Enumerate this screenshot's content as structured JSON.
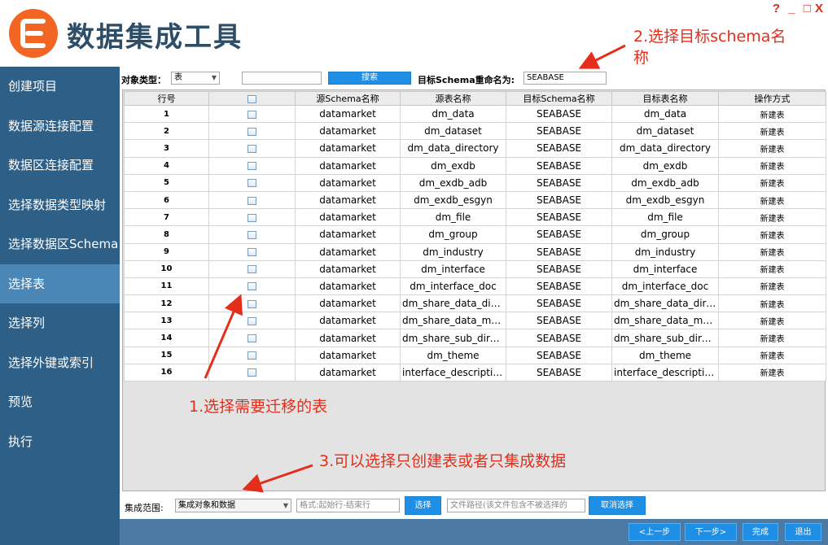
{
  "app": {
    "title": "数据集成工具",
    "window_controls": [
      "?",
      "_",
      "□",
      "X"
    ]
  },
  "sidebar": {
    "items": [
      {
        "label": "创建项目",
        "active": false
      },
      {
        "label": "数据源连接配置",
        "active": false
      },
      {
        "label": "数据区连接配置",
        "active": false
      },
      {
        "label": "选择数据类型映射",
        "active": false
      },
      {
        "label": "选择数据区Schema",
        "active": false
      },
      {
        "label": "选择表",
        "active": true
      },
      {
        "label": "选择列",
        "active": false
      },
      {
        "label": "选择外键或索引",
        "active": false
      },
      {
        "label": "预览",
        "active": false
      },
      {
        "label": "执行",
        "active": false
      }
    ]
  },
  "toolbar": {
    "object_type_label": "对象类型：",
    "object_type_value": "表",
    "search_value": "",
    "search_button": "搜索",
    "rename_label": "目标Schema重命名为:",
    "rename_value": "SEABASE"
  },
  "table": {
    "columns": [
      "行号",
      "",
      "源Schema名称",
      "源表名称",
      "目标Schema名称",
      "目标表名称",
      "操作方式"
    ],
    "rows": [
      [
        "1",
        "datamarket",
        "dm_data",
        "SEABASE",
        "dm_data",
        "新建表"
      ],
      [
        "2",
        "datamarket",
        "dm_dataset",
        "SEABASE",
        "dm_dataset",
        "新建表"
      ],
      [
        "3",
        "datamarket",
        "dm_data_directory",
        "SEABASE",
        "dm_data_directory",
        "新建表"
      ],
      [
        "4",
        "datamarket",
        "dm_exdb",
        "SEABASE",
        "dm_exdb",
        "新建表"
      ],
      [
        "5",
        "datamarket",
        "dm_exdb_adb",
        "SEABASE",
        "dm_exdb_adb",
        "新建表"
      ],
      [
        "6",
        "datamarket",
        "dm_exdb_esgyn",
        "SEABASE",
        "dm_exdb_esgyn",
        "新建表"
      ],
      [
        "7",
        "datamarket",
        "dm_file",
        "SEABASE",
        "dm_file",
        "新建表"
      ],
      [
        "8",
        "datamarket",
        "dm_group",
        "SEABASE",
        "dm_group",
        "新建表"
      ],
      [
        "9",
        "datamarket",
        "dm_industry",
        "SEABASE",
        "dm_industry",
        "新建表"
      ],
      [
        "10",
        "datamarket",
        "dm_interface",
        "SEABASE",
        "dm_interface",
        "新建表"
      ],
      [
        "11",
        "datamarket",
        "dm_interface_doc",
        "SEABASE",
        "dm_interface_doc",
        "新建表"
      ],
      [
        "12",
        "datamarket",
        "dm_share_data_direc...",
        "SEABASE",
        "dm_share_data_direc...",
        "新建表"
      ],
      [
        "13",
        "datamarket",
        "dm_share_data_meta",
        "SEABASE",
        "dm_share_data_meta",
        "新建表"
      ],
      [
        "14",
        "datamarket",
        "dm_share_sub_direct...",
        "SEABASE",
        "dm_share_sub_direct...",
        "新建表"
      ],
      [
        "15",
        "datamarket",
        "dm_theme",
        "SEABASE",
        "dm_theme",
        "新建表"
      ],
      [
        "16",
        "datamarket",
        "interface_description",
        "SEABASE",
        "interface_description",
        "新建表"
      ]
    ]
  },
  "footer": {
    "scope_label": "集成范围:",
    "scope_value": "集成对象和数据",
    "range_placeholder": "格式:起始行-结束行",
    "select_button": "选择",
    "path_placeholder": "文件路径(该文件包含不被选择的",
    "deselect_button": "取消选择"
  },
  "nav": {
    "prev": "<上一步",
    "next": "下一步>",
    "finish": "完成",
    "exit": "退出"
  },
  "annotations": {
    "a1": "1.选择需要迁移的表",
    "a2_line1": "2.选择目标schema名",
    "a2_line2": "称",
    "a3": "3.可以选择只创建表或者只集成数据"
  },
  "colors": {
    "sidebar": "#2e5f86",
    "sidebar_active": "#4a86b6",
    "button": "#1f8fe6",
    "annotation": "#e52d1b",
    "title": "#2e4d66"
  }
}
